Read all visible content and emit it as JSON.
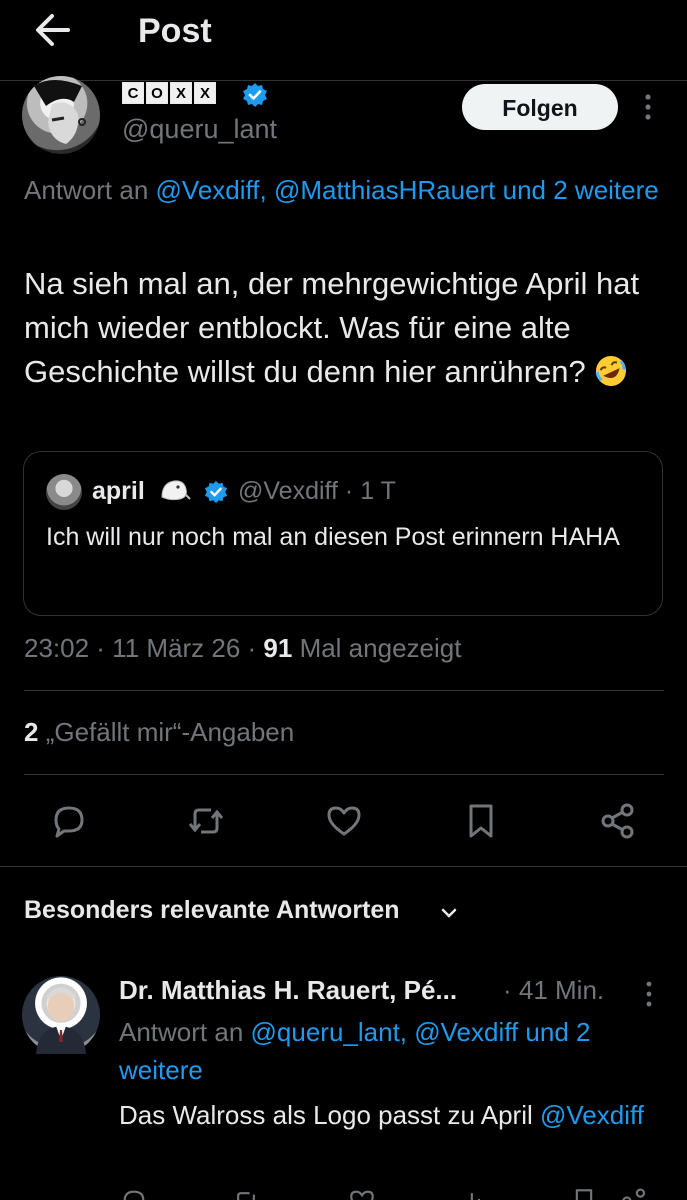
{
  "header": {
    "title": "Post"
  },
  "author": {
    "name_letters": [
      "C",
      "O",
      "X",
      "X"
    ],
    "handle": "@queru_lant",
    "follow_label": "Folgen"
  },
  "post": {
    "reply_to_prefix": "Antwort an ",
    "reply_to_mentions": "@Vexdiff, @MatthiasHRauert und 2 weitere",
    "text": "Na sieh mal an, der mehrgewichtige April hat mich wieder entblockt. Was für eine alte Geschichte willst du denn hier anrühren?",
    "quote": {
      "name": "april",
      "handle_time": "@Vexdiff · 1 T",
      "text": "Ich will nur noch mal an diesen Post erinnern HAHA"
    },
    "time": "23:02 · 11 März 26 · ",
    "views_count": "91",
    "views_label": " Mal angezeigt",
    "likes_count": "2",
    "likes_label": " „Gefällt mir“-Angaben"
  },
  "section": {
    "sort_label": "Besonders relevante Antworten"
  },
  "reply": {
    "name": "Dr. Matthias H. Rauert, Pé...",
    "time": "· 41 Min.",
    "reply_to_prefix": "Antwort an ",
    "reply_to_mentions": "@queru_lant, @Vexdiff und 2 weitere",
    "text": "Das Walross als Logo passt zu April ",
    "mention": "@Vexdiff"
  },
  "colors": {
    "background": "#000000",
    "text": "#e7e9ea",
    "muted": "#71767b",
    "link": "#1d9bf0",
    "divider": "#2f3336"
  },
  "icons": [
    "back-arrow-icon",
    "verified-badge-icon",
    "more-icon",
    "reply-icon",
    "repost-icon",
    "like-icon",
    "bookmark-icon",
    "share-icon",
    "chevron-down-icon"
  ]
}
